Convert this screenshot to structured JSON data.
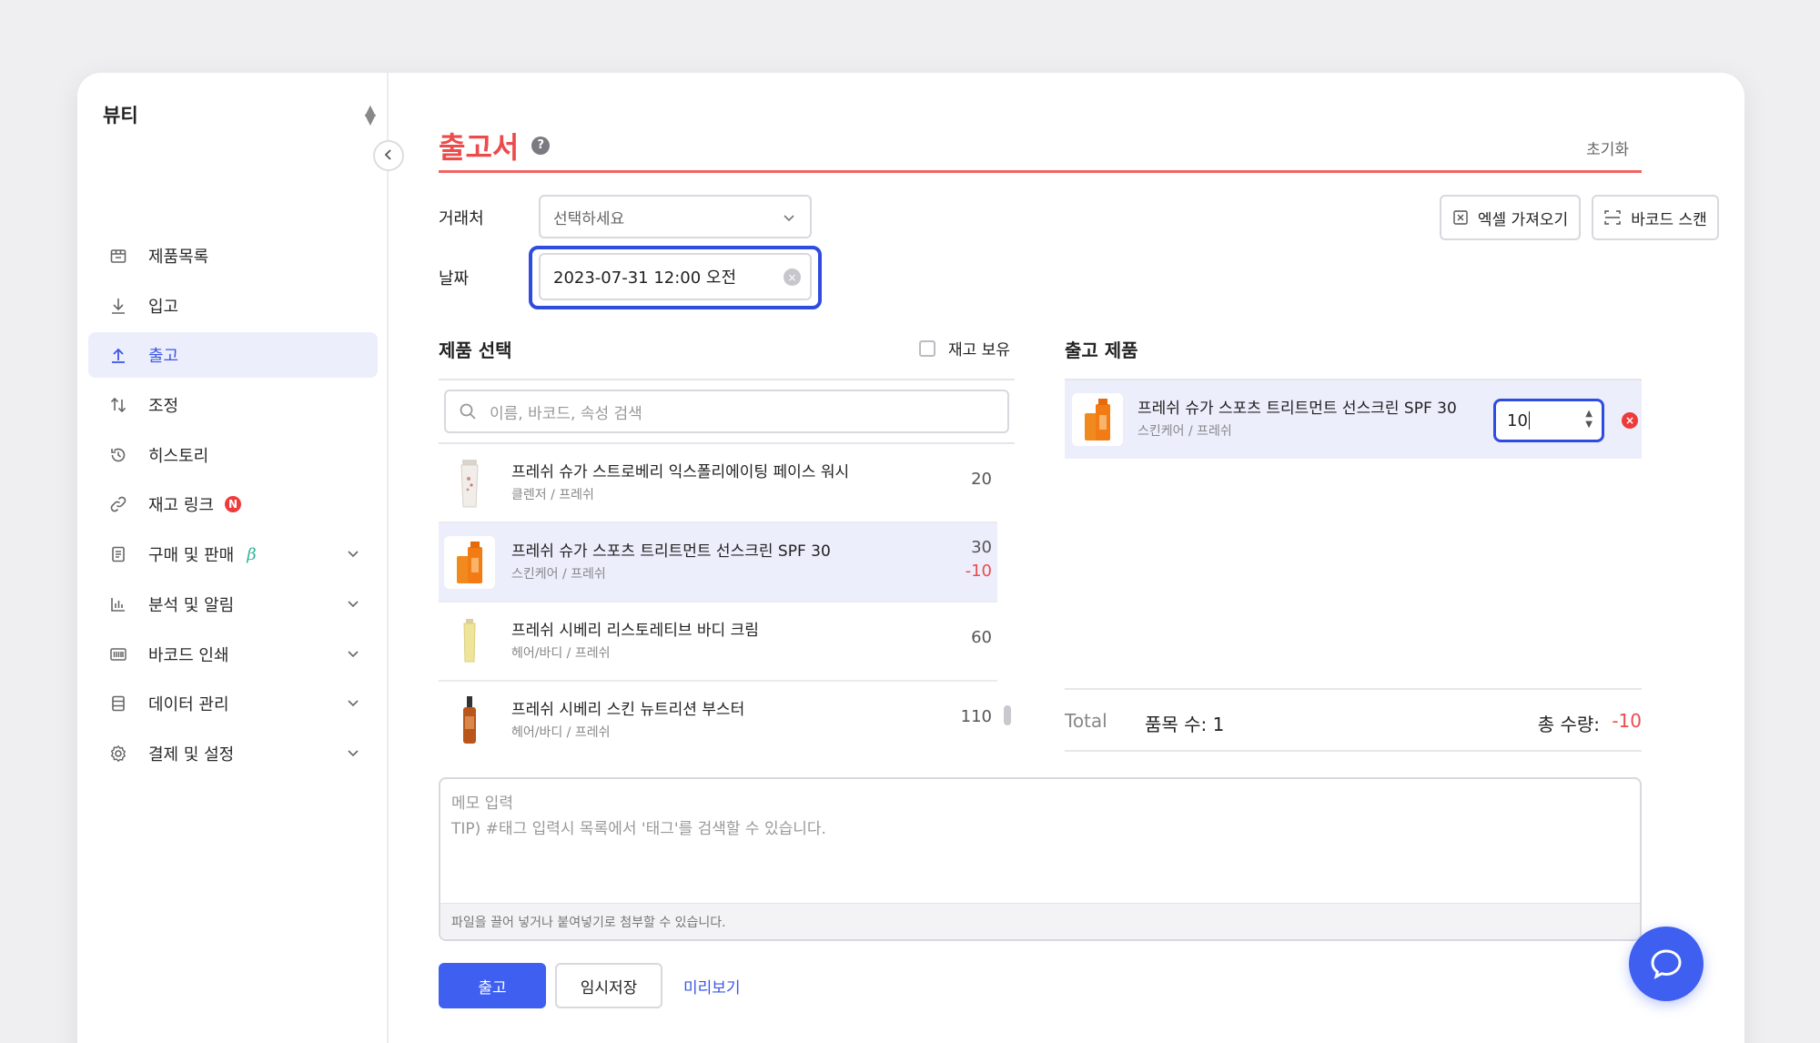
{
  "sidebar": {
    "workspace": "뷰티",
    "items": [
      {
        "label": "제품목록",
        "icon": "box-icon"
      },
      {
        "label": "입고",
        "icon": "arrow-down-icon"
      },
      {
        "label": "출고",
        "icon": "arrow-up-icon",
        "active": true
      },
      {
        "label": "조정",
        "icon": "swap-arrows-icon"
      },
      {
        "label": "히스토리",
        "icon": "history-icon"
      },
      {
        "label": "재고 링크",
        "icon": "link-icon",
        "badge": "N"
      },
      {
        "label": "구매 및 판매",
        "icon": "document-icon",
        "beta": "β"
      },
      {
        "label": "분석 및 알림",
        "icon": "bar-chart-icon"
      },
      {
        "label": "바코드 인쇄",
        "icon": "barcode-icon"
      },
      {
        "label": "데이터 관리",
        "icon": "database-icon"
      },
      {
        "label": "결제 및 설정",
        "icon": "gear-icon"
      }
    ]
  },
  "header": {
    "title": "출고서",
    "help": "?",
    "reset": "초기화"
  },
  "form": {
    "partner_label": "거래처",
    "partner_placeholder": "선택하세요",
    "date_label": "날짜",
    "date_value": "2023-07-31 12:00 오전",
    "excel_button": "엑셀 가져오기",
    "barcode_button": "바코드 스캔"
  },
  "product_select": {
    "title": "제품 선택",
    "stock_filter": "재고 보유",
    "search_placeholder": "이름, 바코드, 속성 검색",
    "rows": [
      {
        "name": "프레쉬 슈가 스트로베리 익스폴리에이팅 페이스 워시",
        "category": "클렌저 / 프레쉬",
        "qty": "20"
      },
      {
        "name": "프레쉬 슈가 스포츠 트리트먼트 선스크린 SPF 30",
        "category": "스킨케어 / 프레쉬",
        "qty": "30",
        "delta": "-10",
        "selected": true
      },
      {
        "name": "프레쉬 시베리 리스토레티브 바디 크림",
        "category": "헤어/바디 / 프레쉬",
        "qty": "60"
      },
      {
        "name": "프레쉬 시베리 스킨 뉴트리션 부스터",
        "category": "헤어/바디 / 프레쉬",
        "qty": "110"
      }
    ]
  },
  "outgoing": {
    "title": "출고 제품",
    "item": {
      "name": "프레쉬 슈가 스포츠 트리트먼트 선스크린 SPF 30",
      "category": "스킨케어 / 프레쉬",
      "quantity": "10"
    },
    "total_label": "Total",
    "count_label": "품목 수:  1",
    "sum_label": "총 수량:",
    "sum_value": "-10"
  },
  "memo": {
    "placeholder_line1": "메모 입력",
    "placeholder_line2": "TIP) #태그 입력시 목록에서 '태그'를 검색할 수 있습니다.",
    "attach_hint": "파일을 끌어 넣거나 붙여넣기로 첨부할 수 있습니다."
  },
  "actions": {
    "submit": "출고",
    "draft": "임시저장",
    "preview": "미리보기"
  },
  "colors": {
    "accent": "#3e5ff0",
    "title_red": "#ec4b4b",
    "active_bg": "#eceefc"
  }
}
